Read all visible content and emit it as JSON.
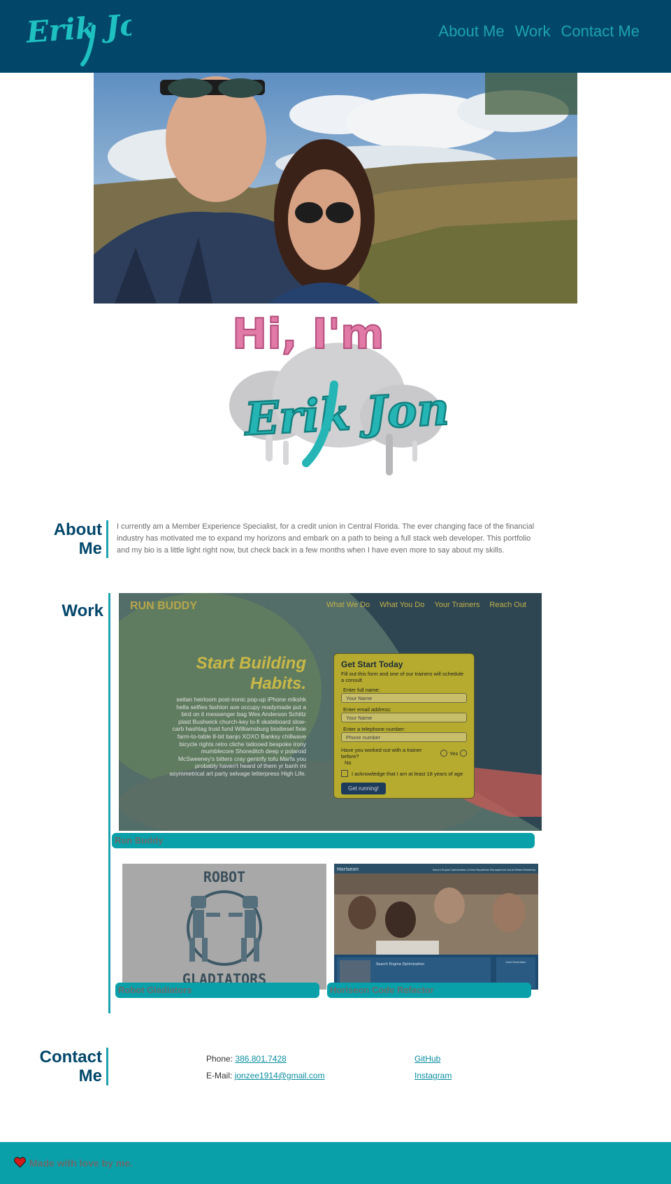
{
  "header": {
    "logo_text": "Erik Jones",
    "nav": [
      {
        "label": "About Me"
      },
      {
        "label": "Work"
      },
      {
        "label": "Contact Me"
      }
    ]
  },
  "hero": {
    "hi_text": "Hi, I'm",
    "hi_name": "Erik Jones"
  },
  "about": {
    "title_line1": "About",
    "title_line2": "Me",
    "body": "I currently am a Member Experience Specialist, for a credit union in Central Florida. The ever changing face of the financial industry has motivated me to expand my horizons and embark on a path to being a full stack web developer. This portfolio and my bio is a little light right now, but check back in a few months when I have even more to say about my skills."
  },
  "work": {
    "title": "Work",
    "projects": [
      {
        "label": "Run Buddy"
      },
      {
        "label": "Robot Gladiators"
      },
      {
        "label": "Horiseon Code Refactor"
      }
    ],
    "run_buddy": {
      "brand": "RUN BUDDY",
      "nav": [
        "What We Do",
        "What You Do",
        "Your Trainers",
        "Reach Out"
      ],
      "headline": "Start Building Habits.",
      "body": "seitan heirloom post-ironic pop-up iPhone mlkshk hella selfies fashion axe occupy readymade put a bird on it messenger bag Wes Anderson Schlitz plaid Bushwick church-key lo-fi skateboard slow-carb hashtag trust fund Williamsburg biodiesel fixie farm-to-table 8-bit banjo XOXO Banksy chillwave bicycle rights retro cliche tattooed bespoke irony mumblecore Shoreditch deep v polaroid McSweeney's bitters cray gentrify tofu Marfa you probably haven't heard of them yr banh mi asymmetrical art party selvage letterpress High Life.",
      "form_title": "Get Start Today",
      "form_desc": "Fill out this form and one of our trainers will schedule a consult",
      "name_label": "Enter full name:",
      "name_placeholder": "Your Name",
      "email_label": "Enter email address:",
      "email_placeholder": "Your Name",
      "phone_label": "Enter a telephone number:",
      "phone_placeholder": "Phone number",
      "trainer_q": "Have you worked out with a trainer before?",
      "yes": "Yes",
      "no": "No",
      "ack": "I acknowledge that I am at least 18 years of age",
      "button": "Get running!"
    },
    "robot": {
      "top_word": "ROBOT",
      "bottom_word": "GLADIATORS"
    },
    "horiseon": {
      "brand": "Horiseon",
      "nav": "Search Engine Optimization   Online Reputation Management   Social Media Marketing",
      "panel_title": "Search Engine Optimization",
      "side_title": "Lead Generation"
    }
  },
  "contact": {
    "title_line1": "Contact",
    "title_line2": "Me",
    "phone_label": "Phone:",
    "phone": "386.801.7428",
    "email_label": "E-Mail:",
    "email": "jonzee1914@gmail.com",
    "github": "GitHub",
    "instagram": "Instagram"
  },
  "footer": {
    "text": "Made with love by me."
  },
  "colors": {
    "header_bg": "#02476a",
    "accent": "#1ea3b0",
    "footer_bg": "#0aa0aa"
  }
}
